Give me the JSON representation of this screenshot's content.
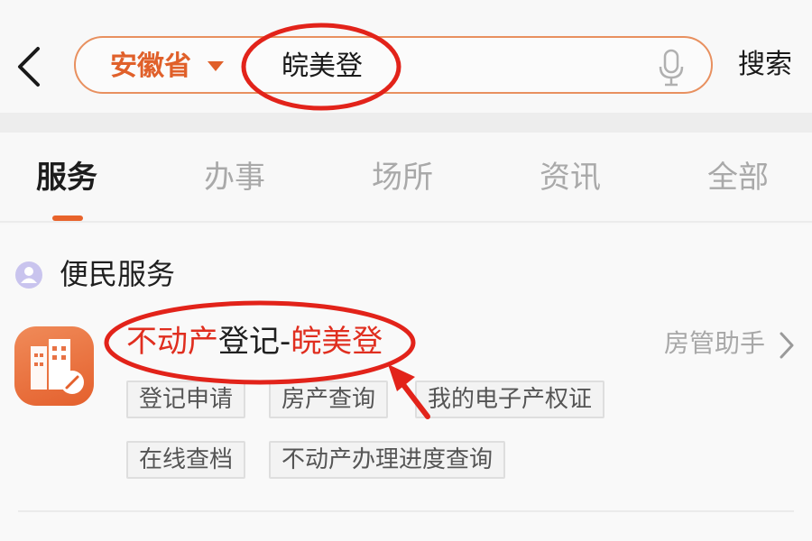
{
  "header": {
    "back_icon": "chevron-left-icon",
    "search": {
      "province": "安徽省",
      "province_icon": "caret-down-icon",
      "query": "皖美登",
      "mic_icon": "microphone-icon"
    },
    "search_label": "搜索"
  },
  "tabs": [
    {
      "label": "服务",
      "active": true
    },
    {
      "label": "办事",
      "active": false
    },
    {
      "label": "场所",
      "active": false
    },
    {
      "label": "资讯",
      "active": false
    },
    {
      "label": "全部",
      "active": false
    }
  ],
  "section": {
    "icon": "user-group-icon",
    "title": "便民服务"
  },
  "service": {
    "icon": "building-pen-icon",
    "title_part1": "不动产",
    "title_part2": "登记-",
    "title_part3": "皖美登",
    "assistant_label": "房管助手",
    "assistant_icon": "chevron-right-icon",
    "tags": [
      "登记申请",
      "房产查询",
      "我的电子产权证",
      "在线查档",
      "不动产办理进度查询"
    ]
  },
  "colors": {
    "accent": "#e8632b",
    "highlight_text": "#e02e1f",
    "annotation_red": "#e2231a",
    "muted": "#a9a9a9"
  }
}
